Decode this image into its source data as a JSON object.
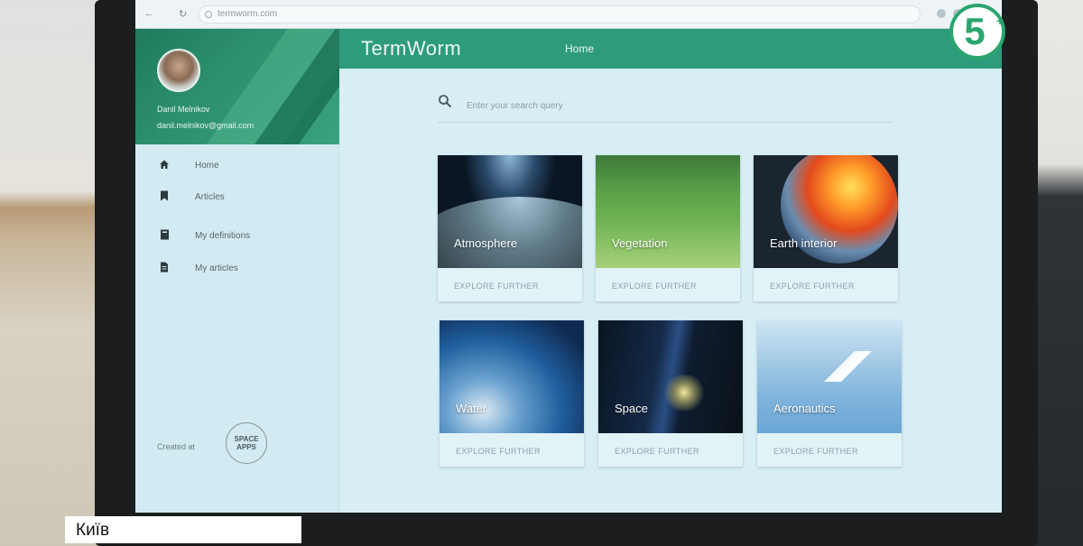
{
  "browser": {
    "url": "termworm.com",
    "back_label": "←",
    "refresh_label": "↻"
  },
  "drawer": {
    "user_name": "Danil Melnikov",
    "user_email": "danil.melnikov@gmail.com",
    "items": [
      {
        "label": "Home",
        "icon": "home-icon"
      },
      {
        "label": "Articles",
        "icon": "bookmark-icon"
      },
      {
        "label": "My definitions",
        "icon": "book-icon"
      },
      {
        "label": "My articles",
        "icon": "document-icon"
      }
    ],
    "created_label": "Created at",
    "sponsor_logo_text": "SPACE APPS"
  },
  "appbar": {
    "brand": "TermWorm",
    "nav_home": "Home"
  },
  "search": {
    "placeholder": "Enter your search query"
  },
  "cards": [
    {
      "title": "Atmosphere",
      "action": "EXPLORE FURTHER"
    },
    {
      "title": "Vegetation",
      "action": "EXPLORE FURTHER"
    },
    {
      "title": "Earth interior",
      "action": "EXPLORE FURTHER"
    },
    {
      "title": "Water",
      "action": "EXPLORE FURTHER"
    },
    {
      "title": "Space",
      "action": "EXPLORE FURTHER"
    },
    {
      "title": "Aeronautics",
      "action": "EXPLORE FURTHER"
    }
  ],
  "overlay": {
    "channel_logo": "5",
    "channel_plus": "+",
    "location_caption": "Київ"
  },
  "colors": {
    "accent": "#2e9b7c",
    "drawer_bg": "#d2ebf2",
    "page_bg": "#d7eef5"
  }
}
